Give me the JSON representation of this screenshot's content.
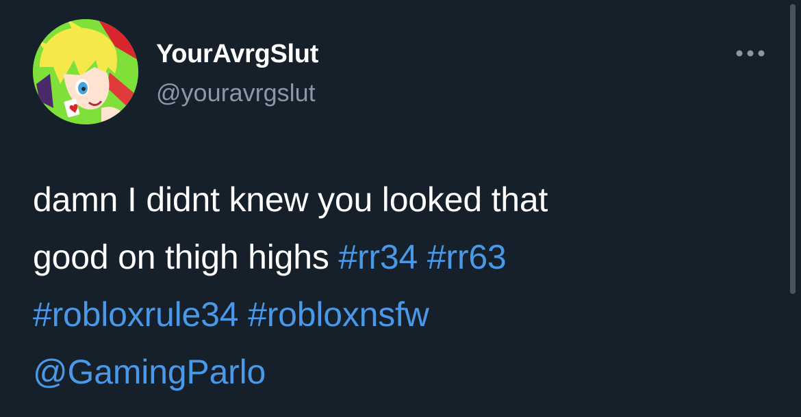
{
  "tweet": {
    "author": {
      "display_name": "YourAvrgSlut",
      "handle": "@youravrgslut",
      "avatar_icon": "anime-character-avatar"
    },
    "more_icon": "more-horizontal-icon",
    "text_line1": "damn I didnt knew you looked that",
    "text_line2_plain": "good on thigh highs ",
    "hashtags": [
      "#rr34",
      "#rr63",
      "#robloxrule34",
      "#robloxnsfw"
    ],
    "mention": "@GamingParlo"
  },
  "colors": {
    "background": "#15202b",
    "text_primary": "#ffffff",
    "text_secondary": "#8b98a5",
    "link": "#4a99e9",
    "avatar_bg": "#7fe03a"
  }
}
